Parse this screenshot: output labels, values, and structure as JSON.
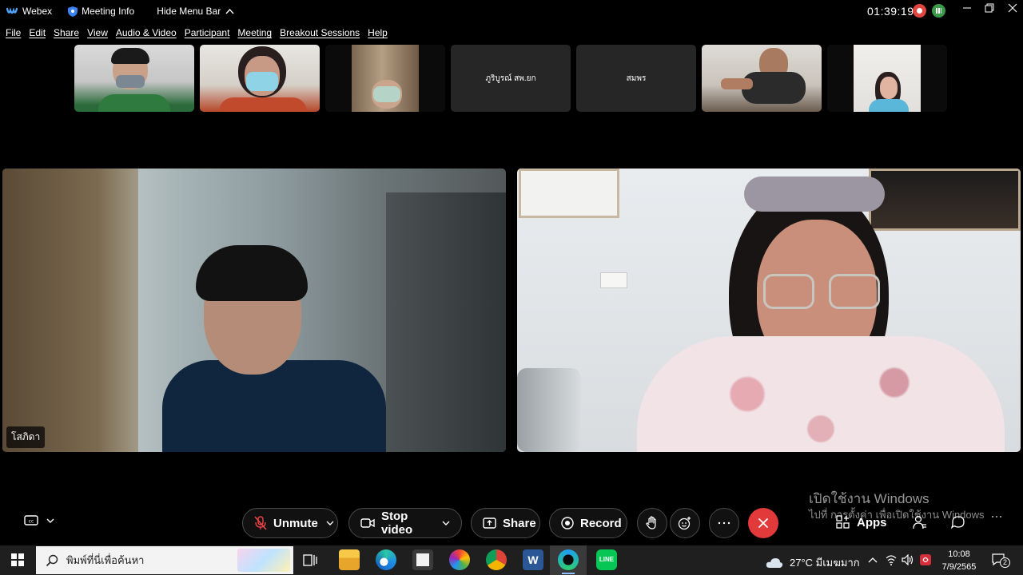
{
  "titlebar": {
    "app_name": "Webex",
    "meeting_info": "Meeting Info",
    "hide_menu": "Hide Menu Bar",
    "clock": "01:39:19"
  },
  "menu": [
    "File",
    "Edit",
    "Share",
    "View",
    "Audio & Video",
    "Participant",
    "Meeting",
    "Breakout Sessions",
    "Help"
  ],
  "thumbnails": [
    {
      "name": "",
      "type": "video"
    },
    {
      "name": "",
      "type": "video"
    },
    {
      "name": "",
      "type": "video"
    },
    {
      "name": "ภูริบูรณ์ สพ.ยก",
      "type": "name"
    },
    {
      "name": "สมพร",
      "type": "name"
    },
    {
      "name": "",
      "type": "video"
    },
    {
      "name": "",
      "type": "video"
    }
  ],
  "main_tiles": {
    "left_name": "โสภิดา"
  },
  "controls": {
    "unmute": "Unmute",
    "stop_video": "Stop video",
    "share": "Share",
    "record": "Record",
    "apps": "Apps"
  },
  "watermark": {
    "line1": "เปิดใช้งาน Windows",
    "line2": "ไปที่ การตั้งค่า เพื่อเปิดใช้งาน Windows"
  },
  "taskbar": {
    "search_placeholder": "พิมพ์ที่นี่เพื่อค้นหา",
    "weather": "27°C  มีเมฆมาก",
    "time": "10:08",
    "date": "7/9/2565",
    "notification_count": "2"
  },
  "colors": {
    "leave_red": "#e23a3a",
    "record_red": "#e0463f",
    "background": "#000000"
  }
}
